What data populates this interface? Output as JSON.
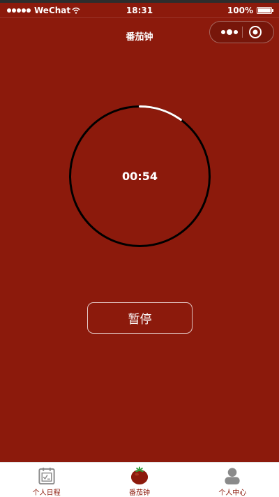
{
  "status_bar": {
    "carrier": "WeChat",
    "time": "18:31",
    "battery": "100%"
  },
  "nav": {
    "title": "番茄钟"
  },
  "timer": {
    "display": "00:54",
    "progress": 0.1
  },
  "actions": {
    "pause_label": "暂停"
  },
  "tab_bar": {
    "items": [
      {
        "label": "个人日程",
        "icon": "calendar-icon"
      },
      {
        "label": "番茄钟",
        "icon": "tomato-icon"
      },
      {
        "label": "个人中心",
        "icon": "user-icon"
      }
    ]
  },
  "colors": {
    "background": "#8c1a0c",
    "ring": "#000000",
    "progress": "#ffffff",
    "tab_label": "#8c1a0c"
  }
}
